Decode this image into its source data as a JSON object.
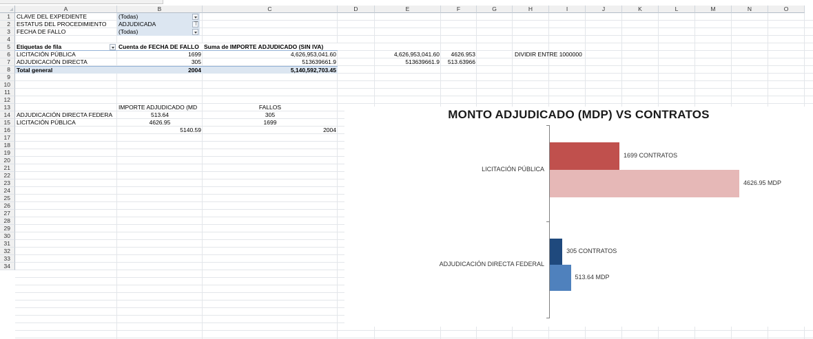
{
  "columns": [
    "A",
    "B",
    "C",
    "D",
    "E",
    "F",
    "G",
    "H",
    "I",
    "J",
    "K",
    "L",
    "M",
    "N",
    "O"
  ],
  "rows": [
    "1",
    "2",
    "3",
    "4",
    "5",
    "6",
    "7",
    "8",
    "9",
    "10",
    "11",
    "12",
    "13",
    "14",
    "15",
    "16",
    "17",
    "18",
    "19",
    "20",
    "21",
    "22",
    "23",
    "24",
    "25",
    "26",
    "27",
    "28",
    "29",
    "30",
    "31",
    "32",
    "33",
    "34"
  ],
  "filters": [
    {
      "label": "CLAVE DEL EXPEDIENTE",
      "value": "(Todas)"
    },
    {
      "label": "ESTATUS DEL PROCEDIMIENTO",
      "value": "ADJUDICADA"
    },
    {
      "label": "FECHA DE FALLO",
      "value": "(Todas)"
    }
  ],
  "pivot": {
    "headers": [
      "Etiquetas de fila",
      "Cuenta de FECHA DE FALLO",
      "Suma de  IMPORTE ADJUDICADO (SIN IVA)"
    ],
    "rows": [
      {
        "label": "LICITACIÓN PÚBLICA",
        "count": "1699",
        "sum": "4,626,953,041.60",
        "e": "4,626,953,041.60",
        "f": "4626.953"
      },
      {
        "label": "ADJUDICACIÓN DIRECTA",
        "count": "305",
        "sum": "513639661.9",
        "e": "513639661.9",
        "f": "513.63966"
      }
    ],
    "total": {
      "label": "Total general",
      "count": "2004",
      "sum": "5,140,592,703.45"
    },
    "note": "DIVIDIR ENTRE 1000000"
  },
  "table2": {
    "headers": [
      "IMPORTE ADJUDICADO (MD",
      "FALLOS"
    ],
    "rows": [
      {
        "label": "ADJUDICACIÓN DIRECTA FEDERA",
        "importe": "513.64",
        "fallos": "305"
      },
      {
        "label": "LICITACIÓN PÚBLICA",
        "importe": "4626.95",
        "fallos": "1699"
      }
    ],
    "total_importe": "5140.59",
    "total_fallos": "2004"
  },
  "chart_data": {
    "type": "bar",
    "title": "MONTO ADJUDICADO (MDP) VS CONTRATOS",
    "categories": [
      "LICITACIÓN PÚBLICA",
      "ADJUDICACIÓN DIRECTA FEDERAL"
    ],
    "series": [
      {
        "values": [
          1699,
          305
        ],
        "labels": [
          "1699 CONTRATOS",
          "305 CONTRATOS"
        ],
        "colors": [
          "#c0504d",
          "#1f497d"
        ]
      },
      {
        "values": [
          4626.95,
          513.64
        ],
        "labels": [
          "4626.95 MDP",
          "513.64 MDP"
        ],
        "colors": [
          "#e6b8b7",
          "#4f81bd"
        ]
      }
    ],
    "orientation": "horizontal"
  }
}
